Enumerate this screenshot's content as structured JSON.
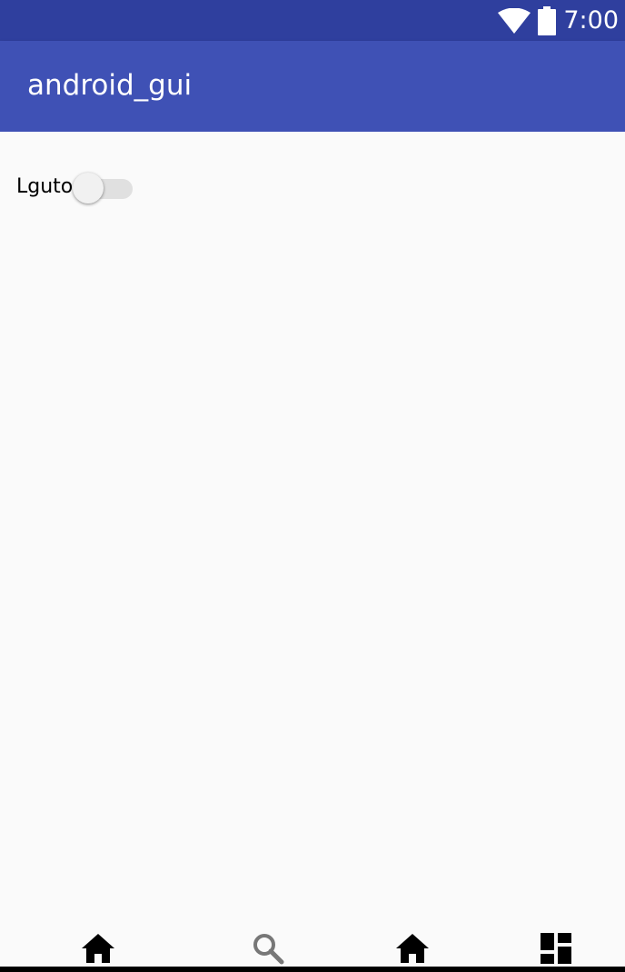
{
  "status_bar": {
    "time": "7:00",
    "icons": [
      "wifi-icon",
      "battery-icon"
    ],
    "background_color": "#2f3f9e"
  },
  "app_bar": {
    "title": "android_gui",
    "background_color": "#3f51b5"
  },
  "content": {
    "switch": {
      "label": "Lguto",
      "checked": false
    }
  },
  "bottom_nav": {
    "items": [
      {
        "icon": "home-icon",
        "selected": true
      },
      {
        "icon": "search-icon",
        "selected": false
      },
      {
        "icon": "home-icon",
        "selected": true
      },
      {
        "icon": "dashboard-icon",
        "selected": true
      }
    ]
  }
}
